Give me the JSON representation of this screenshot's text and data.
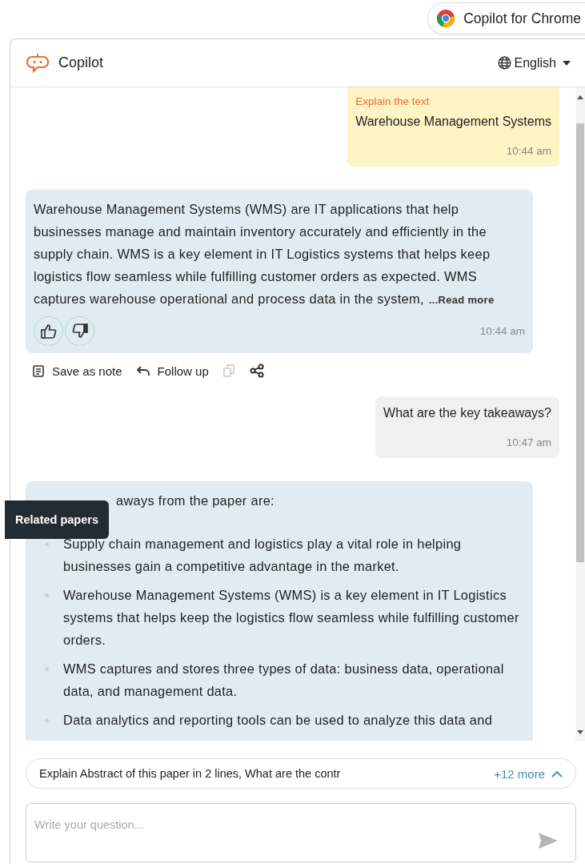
{
  "extension_chip": {
    "label": "Copilot for Chrome"
  },
  "header": {
    "title": "Copilot",
    "language": "English"
  },
  "messages": [
    {
      "kind": "user",
      "tag": "Explain the text",
      "text": "Warehouse Management Systems",
      "time": "10:44 am"
    },
    {
      "kind": "bot",
      "text": "Warehouse Management Systems (WMS) are IT applications that help businesses manage and maintain inventory accurately and efficiently in the supply chain. WMS is a key element in IT Logistics systems that helps keep logistics flow seamless while fulfilling customer orders as expected. WMS captures warehouse operational and process data in the system,",
      "read_more": "...Read more",
      "time": "10:44 am"
    },
    {
      "kind": "actions",
      "items": [
        {
          "kind": "note",
          "label": "Save as note",
          "disabled": false
        },
        {
          "kind": "follow",
          "label": "Follow up",
          "disabled": false
        },
        {
          "kind": "copy",
          "disabled": true
        },
        {
          "kind": "share",
          "disabled": false
        }
      ]
    },
    {
      "kind": "user",
      "text": "What are the key takeaways?",
      "time": "10:47 am"
    },
    {
      "kind": "bot_list",
      "intro": "aways from the paper are:",
      "items": [
        "Supply chain management and logistics play a vital role in helping businesses gain a competitive advantage in the market.",
        "Warehouse Management Systems (WMS) is a key element in IT Logistics systems that helps keep the logistics flow seamless while fulfilling customer orders.",
        "WMS captures and stores three types of data: business data, operational data, and management data.",
        "Data analytics and reporting tools can be used to analyze this data and"
      ]
    }
  ],
  "tooltip": {
    "text": "Related papers"
  },
  "suggestions": {
    "text": "Explain Abstract of this paper in 2 lines, What are the contr",
    "more": "+12 more"
  },
  "input": {
    "placeholder": "Write your question..."
  }
}
